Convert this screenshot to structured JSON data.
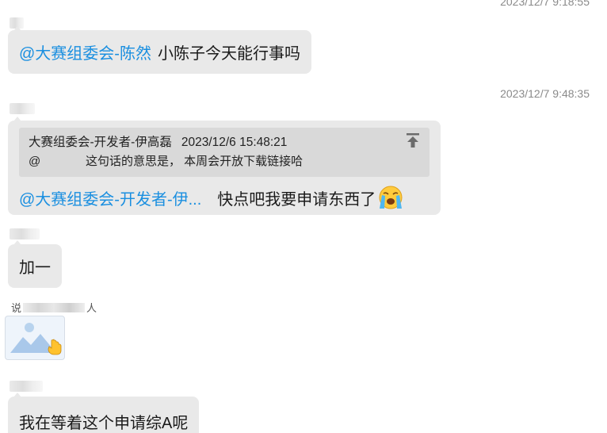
{
  "messages": [
    {
      "timestamp": "2023/12/7 9:18:55",
      "mention": "@大赛组委会-陈然",
      "text": "小陈子今天能行事吗"
    },
    {
      "timestamp": "2023/12/7 9:48:35",
      "quote": {
        "author": "大赛组委会-开发者-伊高磊",
        "time": "2023/12/6 15:48:21",
        "at": "@",
        "text": "这句话的意思是， 本周会开放下载链接哈"
      },
      "mention": "@大赛组委会-开发者-伊...",
      "text": "快点吧我要申请东西了",
      "emoji": "loudly-crying-face"
    },
    {
      "text": "加一"
    },
    {
      "system_note_prefix": "说",
      "system_note_suffix": "人",
      "attachment": "image-thumbnail"
    },
    {
      "text": "我在等着这个申请综A呢"
    }
  ],
  "colors": {
    "mention": "#1a8fe0",
    "bubble": "#e9e9e9",
    "quote_bg": "#d9d9d9",
    "timestamp": "#8a8a8a"
  }
}
